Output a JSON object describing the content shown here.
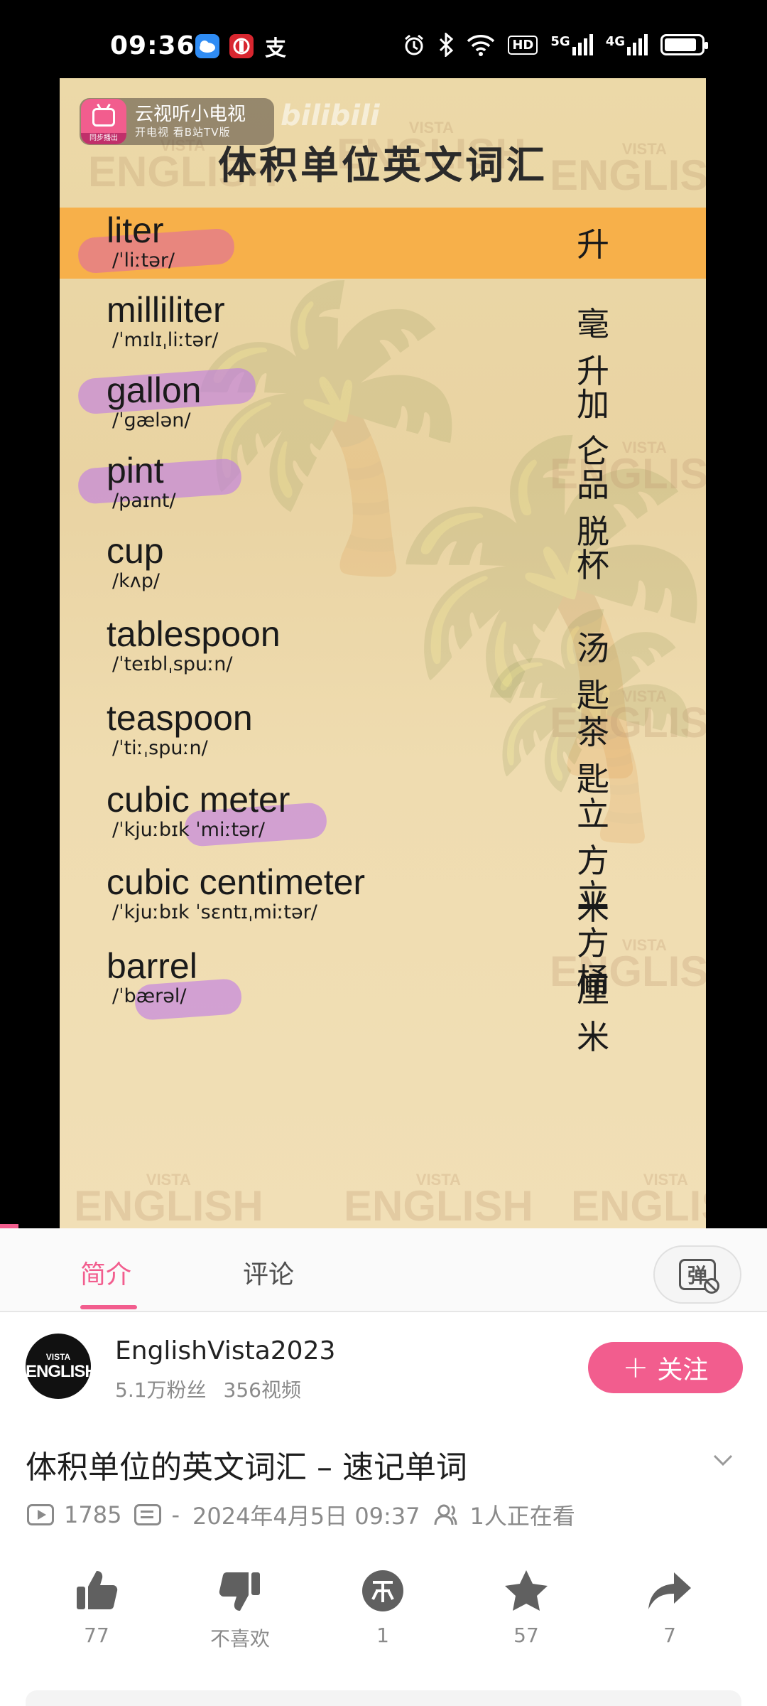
{
  "status_bar": {
    "time": "09:36",
    "app_icons": [
      "weather-icon",
      "bank-icon",
      "alipay-icon"
    ],
    "right_icons": [
      "alarm-icon",
      "bluetooth-icon",
      "wifi-icon",
      "hd-icon",
      "5g-signal-icon",
      "4g-signal-icon",
      "battery-icon"
    ],
    "hd_label": "HD",
    "net1": "5G",
    "net2": "4G",
    "battery_level": 0.9
  },
  "player": {
    "cast_badge_title": "云视听小电视",
    "cast_badge_sub": "开电视 看B站TV版",
    "cast_sync": "同步播出",
    "watermark_logo": "bilibili",
    "frame_title": "体积单位英文词汇",
    "watermark_small": "VISTA",
    "watermark_big": "ENGLISH",
    "highlighted_index": 0,
    "vocab": [
      {
        "word": "liter",
        "ipa": "/ˈliːtər/",
        "cn": "升"
      },
      {
        "word": "milliliter",
        "ipa": "/ˈmɪlɪˌliːtər/",
        "cn": "毫升"
      },
      {
        "word": "gallon",
        "ipa": "/ˈɡælən/",
        "cn": "加仑"
      },
      {
        "word": "pint",
        "ipa": "/paɪnt/",
        "cn": "品脱"
      },
      {
        "word": "cup",
        "ipa": "/kʌp/",
        "cn": "杯"
      },
      {
        "word": "tablespoon",
        "ipa": "/ˈteɪblˌspuːn/",
        "cn": "汤匙"
      },
      {
        "word": "teaspoon",
        "ipa": "/ˈtiːˌspuːn/",
        "cn": "茶匙"
      },
      {
        "word": "cubic meter",
        "ipa": "/ˈkjuːbɪk ˈmiːtər/",
        "cn": "立方米"
      },
      {
        "word": "cubic centimeter",
        "ipa": "/ˈkjuːbɪk ˈsɛntɪˌmiːtər/",
        "cn": "立方厘米"
      },
      {
        "word": "barrel",
        "ipa": "/ˈbærəl/",
        "cn": "桶"
      }
    ]
  },
  "tabs": {
    "intro": "简介",
    "comments": "评论",
    "danmaku_glyph": "弹"
  },
  "uploader": {
    "avatar_small": "VISTA",
    "avatar_big": "ENGLISH",
    "name": "EnglishVista2023",
    "fans": "5.1万粉丝",
    "videos": "356视频",
    "follow_label": "关注"
  },
  "video": {
    "title": "体积单位的英文词汇 – 速记单词",
    "plays": "1785",
    "danmaku": "-",
    "date": "2024年4月5日 09:37",
    "watching": "1人正在看"
  },
  "actions": {
    "like": "77",
    "dislike": "不喜欢",
    "coin": "1",
    "favorite": "57",
    "share": "7"
  },
  "colors": {
    "accent": "#f25d8e",
    "highlight_row": "#f7b04a",
    "muted_text": "#8a8a8a"
  }
}
